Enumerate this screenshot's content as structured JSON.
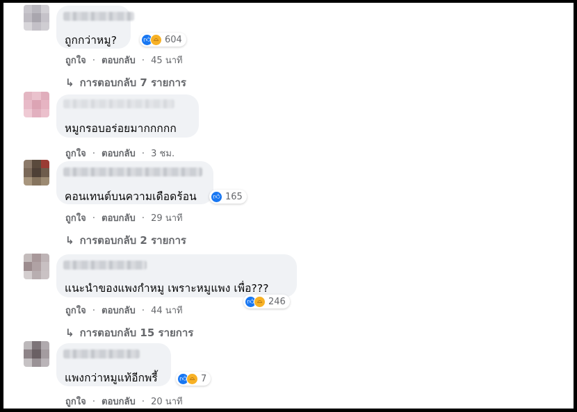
{
  "comments": [
    {
      "text": "ถูกกว่าหมู?",
      "reaction_count": "604",
      "reactions": [
        "like-icon",
        "haha-icon"
      ],
      "meta": {
        "like": "ถูกใจ",
        "reply": "ตอบกลับ",
        "time": "45 นาที"
      },
      "replies": "การตอบกลับ 7 รายการ"
    },
    {
      "name_partial": "​ทางจุหนูง ศเนแหนมเนมง",
      "text": "หมูกรอบอร่อยมากกกกก",
      "meta": {
        "like": "ถูกใจ",
        "reply": "ตอบกลับ",
        "time": "3 ชม."
      }
    },
    {
      "text": "คอนเทนต์บนความเดือดร้อน",
      "reaction_count": "165",
      "reactions": [
        "like-icon"
      ],
      "meta": {
        "like": "ถูกใจ",
        "reply": "ตอบกลับ",
        "time": "29 นาที"
      },
      "replies": "การตอบกลับ 2 รายการ"
    },
    {
      "text": "แนะนำของแพงกำหมู เพราะหมูแพง เพื่อ???",
      "reaction_count": "246",
      "reactions": [
        "like-icon",
        "haha-icon"
      ],
      "meta": {
        "like": "ถูกใจ",
        "reply": "ตอบกลับ",
        "time": "44 นาที"
      },
      "replies": "การตอบกลับ 15 รายการ"
    },
    {
      "text": "แพงกว่าหมูแท้อีกพรี้",
      "reaction_count": "7",
      "reactions": [
        "like-icon",
        "haha-icon"
      ],
      "meta": {
        "like": "ถูกใจ",
        "reply": "ตอบกลับ",
        "time": "20 นาที"
      }
    }
  ],
  "separator": "·",
  "colors": {
    "bubble": "#f0f2f5",
    "meta_text": "#65676b",
    "like_blue": "#1877f2",
    "haha_yellow": "#f7b125"
  }
}
